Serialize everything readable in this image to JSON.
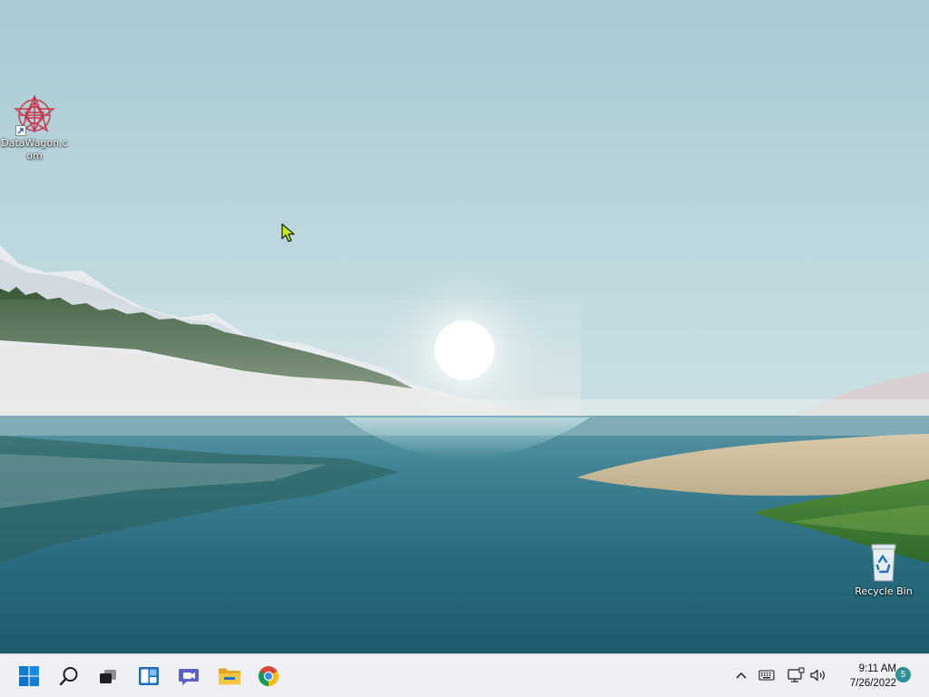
{
  "desktop": {
    "icons": [
      {
        "label": "DataWagon.com",
        "icon": "datawagon-logo-icon",
        "shortcut": true
      },
      {
        "label": "Recycle Bin",
        "icon": "recycle-bin-icon",
        "shortcut": false
      }
    ]
  },
  "taskbar": {
    "pinned": [
      {
        "name": "Start",
        "icon": "windows-logo-icon"
      },
      {
        "name": "Search",
        "icon": "search-icon"
      },
      {
        "name": "Task View",
        "icon": "task-view-icon"
      },
      {
        "name": "Widgets",
        "icon": "widgets-icon"
      },
      {
        "name": "Chat",
        "icon": "teams-chat-icon"
      },
      {
        "name": "File Explorer",
        "icon": "folder-icon"
      },
      {
        "name": "Google Chrome",
        "icon": "chrome-icon"
      }
    ],
    "tray": {
      "icons": [
        "chevron-up-icon",
        "keyboard-icon",
        "network-icon",
        "volume-icon"
      ],
      "time": "9:11 AM",
      "date": "7/26/2022",
      "notification_count": "5"
    }
  },
  "colors": {
    "taskbar_bg": "#eef0f3",
    "windows_blue": "#0078d4",
    "badge": "#2f8f96"
  }
}
